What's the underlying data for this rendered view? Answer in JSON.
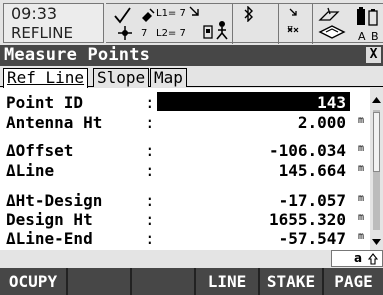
{
  "status": {
    "time": "09:33",
    "mode": "REFLINE",
    "l1_label": "L1= 7",
    "l2_label": "L2= 7",
    "sat_count": "7",
    "battery_labels": [
      "A",
      "B"
    ],
    "icons": [
      "satellite-icon",
      "position-icon",
      "radio-icon",
      "bluetooth-icon",
      "data-icon",
      "memory-icon",
      "battery-icon"
    ]
  },
  "title_bar": {
    "title": "Measure Points",
    "close_glyph": "X"
  },
  "tabs": [
    {
      "label": "Ref Line",
      "active": true
    },
    {
      "label": "Slope",
      "active": false
    },
    {
      "label": "Map",
      "active": false
    }
  ],
  "fields": [
    {
      "label": "Point ID",
      "value": "143",
      "unit": "",
      "selected": true
    },
    {
      "label": "Antenna Ht",
      "value": "2.000",
      "unit": "m"
    },
    {
      "label": "ΔOffset",
      "value": "-106.034",
      "unit": "m"
    },
    {
      "label": "ΔLine",
      "value": "145.664",
      "unit": "m"
    },
    {
      "label": "ΔHt-Design",
      "value": "-17.057",
      "unit": "m"
    },
    {
      "label": "Design Ht",
      "value": "1655.320",
      "unit": "m"
    },
    {
      "label": "ΔLine-End",
      "value": "-57.547",
      "unit": "m"
    }
  ],
  "colon": ":",
  "input_mode": "a",
  "softkeys": [
    "OCUPY",
    "",
    "",
    "LINE",
    "STAKE",
    "PAGE"
  ]
}
